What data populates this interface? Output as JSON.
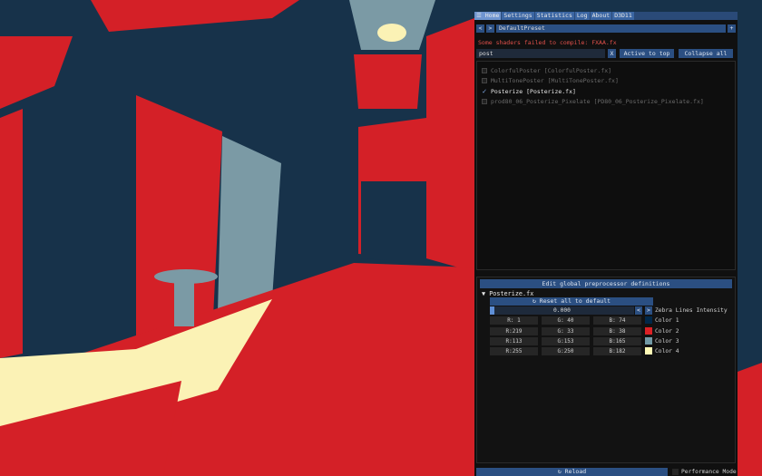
{
  "tabs": [
    "Home",
    "Settings",
    "Statistics",
    "Log",
    "About",
    "D3D11"
  ],
  "menu_icon": "hamburger-icon",
  "preset": {
    "name": "DefaultPreset",
    "prev": "<",
    "next": ">",
    "add": "+"
  },
  "error_text": "Some shaders failed to compile: FXAA.fx",
  "search": {
    "value": "post",
    "clear": "X",
    "active_to_top": "Active to top",
    "collapse_all": "Collapse all"
  },
  "effects": [
    {
      "label": "ColorfulPoster [ColorfulPoster.fx]",
      "enabled": false
    },
    {
      "label": "MultiTonePoster [MultiTonePoster.fx]",
      "enabled": false
    },
    {
      "label": "Posterize [Posterize.fx]",
      "enabled": true
    },
    {
      "label": "prod80_06_Posterize_Pixelate [PD80_06_Posterize_Pixelate.fx]",
      "enabled": false
    }
  ],
  "preproc_button": "Edit global preprocessor definitions",
  "section": {
    "title": "Posterize.fx",
    "reset": "Reset all to default"
  },
  "slider": {
    "value_text": "0.000",
    "dec": "<",
    "inc": ">",
    "label": "Zebra Lines Intensity",
    "fraction": 0.0
  },
  "colors": [
    {
      "r": "R:  1",
      "g": "G: 40",
      "b": "B: 74",
      "label": "Color 1",
      "hex": "#01284a"
    },
    {
      "r": "R:219",
      "g": "G: 33",
      "b": "B: 38",
      "label": "Color 2",
      "hex": "#db2126"
    },
    {
      "r": "R:113",
      "g": "G:153",
      "b": "B:165",
      "label": "Color 3",
      "hex": "#7199a5"
    },
    {
      "r": "R:255",
      "g": "G:250",
      "b": "B:182",
      "label": "Color 4",
      "hex": "#fffab6"
    }
  ],
  "footer": {
    "reload": "Reload",
    "performance": "Performance Mode"
  },
  "palette": {
    "dark": "#17324a",
    "red": "#d42027",
    "blue": "#7b9aa5",
    "cream": "#fbf2b5",
    "accent": "#3b66a3"
  }
}
